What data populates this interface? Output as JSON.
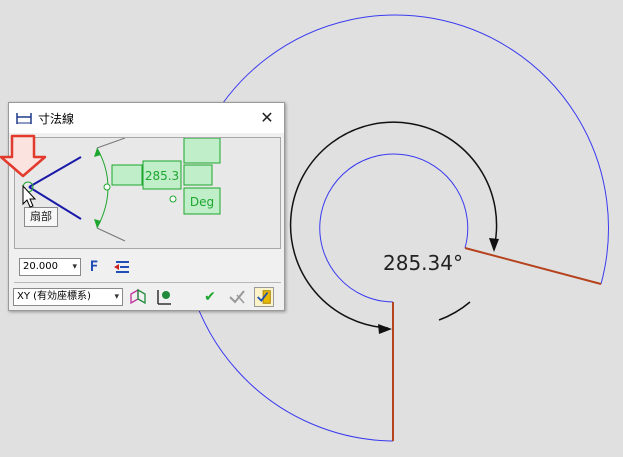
{
  "dialog": {
    "title": "寸法線",
    "title_icon": "dimension-icon",
    "close_label": "✕",
    "preview": {
      "value_box": "285.3",
      "unit_box": "Deg"
    },
    "tooltip": "扇部",
    "text_height": "20.000",
    "coord_system": "XY (有効座標系)",
    "buttons": {
      "font": "F",
      "ok": "✔"
    }
  },
  "canvas": {
    "angle_label": "285.34°",
    "arc_color": "#3a3af0",
    "dim_line_color": "#b5431d",
    "highlight_arrow_color": "#e23b2e",
    "preview_green": "#1ea62e"
  }
}
